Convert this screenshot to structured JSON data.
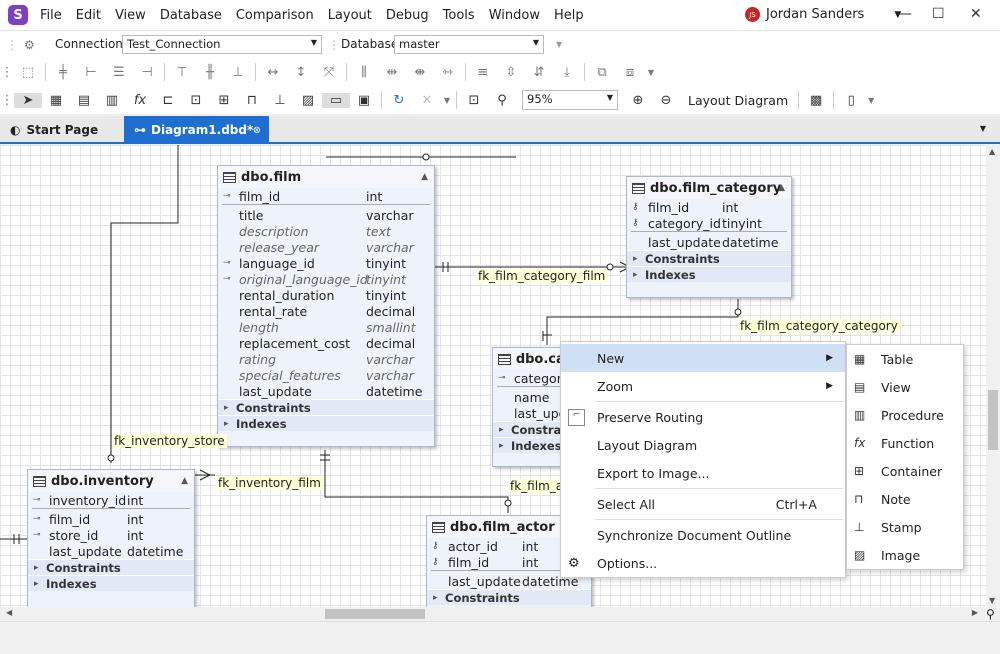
{
  "app": {
    "logo": "S",
    "menu": [
      "File",
      "Edit",
      "View",
      "Database",
      "Comparison",
      "Layout",
      "Debug",
      "Tools",
      "Window",
      "Help"
    ],
    "user": {
      "initials": "JS",
      "name": "Jordan Sanders"
    }
  },
  "connection": {
    "label": "Connection",
    "value": "Test_Connection",
    "db_label": "Database",
    "db_value": "master"
  },
  "toolbar": {
    "zoom": "95%",
    "layout_diagram": "Layout Diagram"
  },
  "tabs": [
    {
      "label": "Start Page"
    },
    {
      "label": "Diagram1.dbd*"
    }
  ],
  "entities": {
    "film": {
      "title": "dbo.film",
      "rows": [
        {
          "name": "film_id",
          "type": "int"
        },
        {
          "name": "title",
          "type": "varchar"
        },
        {
          "name": "description",
          "type": "text"
        },
        {
          "name": "release_year",
          "type": "varchar"
        },
        {
          "name": "language_id",
          "type": "tinyint"
        },
        {
          "name": "original_language_id",
          "type": "tinyint"
        },
        {
          "name": "rental_duration",
          "type": "tinyint"
        },
        {
          "name": "rental_rate",
          "type": "decimal"
        },
        {
          "name": "length",
          "type": "smallint"
        },
        {
          "name": "replacement_cost",
          "type": "decimal"
        },
        {
          "name": "rating",
          "type": "varchar"
        },
        {
          "name": "special_features",
          "type": "varchar"
        },
        {
          "name": "last_update",
          "type": "datetime"
        }
      ],
      "constraints": "Constraints",
      "indexes": "Indexes"
    },
    "film_category": {
      "title": "dbo.film_category",
      "rows": [
        {
          "name": "film_id",
          "type": "int"
        },
        {
          "name": "category_id",
          "type": "tinyint"
        },
        {
          "name": "last_update",
          "type": "datetime"
        }
      ],
      "constraints": "Constraints",
      "indexes": "Indexes"
    },
    "category": {
      "title": "dbo.cat",
      "rows": [
        {
          "name": "category"
        },
        {
          "name": "name"
        },
        {
          "name": "last_upd"
        }
      ],
      "constraints": "Constrai",
      "indexes": "Indexes"
    },
    "inventory": {
      "title": "dbo.inventory",
      "rows": [
        {
          "name": "inventory_id",
          "type": "int"
        },
        {
          "name": "film_id",
          "type": "int"
        },
        {
          "name": "store_id",
          "type": "int"
        },
        {
          "name": "last_update",
          "type": "datetime"
        }
      ],
      "constraints": "Constraints",
      "indexes": "Indexes"
    },
    "film_actor": {
      "title": "dbo.film_actor",
      "rows": [
        {
          "name": "actor_id",
          "type": "int"
        },
        {
          "name": "film_id",
          "type": "int"
        },
        {
          "name": "last_update",
          "type": "datetime"
        }
      ],
      "constraints": "Constraints"
    }
  },
  "fk_labels": [
    "fk_film_category_film",
    "fk_film_category_category",
    "fk_inventory_store",
    "fk_inventory_film",
    "fk_film_a"
  ],
  "context_menu": {
    "new": "New",
    "zoom": "Zoom",
    "preserve_routing": "Preserve Routing",
    "layout_diagram": "Layout Diagram",
    "export": "Export to Image...",
    "select_all": "Select All",
    "select_all_shortcut": "Ctrl+A",
    "sync": "Synchronize Document Outline",
    "options": "Options..."
  },
  "submenu": [
    "Table",
    "View",
    "Procedure",
    "Function",
    "Container",
    "Note",
    "Stamp",
    "Image"
  ]
}
